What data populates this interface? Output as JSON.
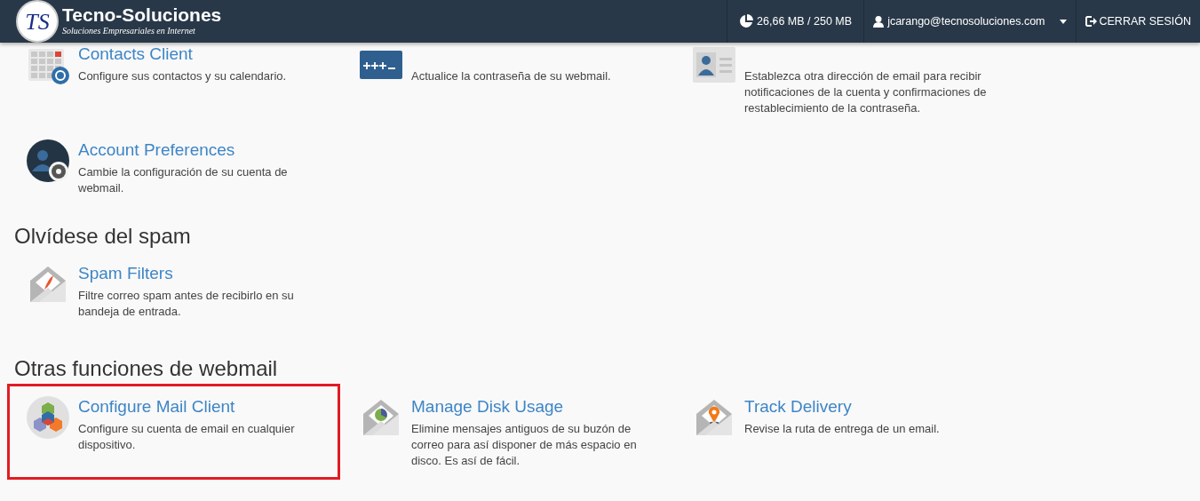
{
  "header": {
    "logo_mark": "TS",
    "brand": "Tecno-Soluciones",
    "tagline": "Soluciones Empresariales en Internet",
    "quota": "26,66 MB / 250 MB",
    "user": "jcarango@tecnosoluciones.com",
    "logout": "CERRAR SESIÓN"
  },
  "sections": [
    {
      "items": [
        {
          "kind": "calendar",
          "title": "Contacts Client",
          "description": "Configure sus contactos y su calendario.",
          "highlighted": false
        },
        {
          "kind": "password",
          "description": "Actualice la contraseña de su webmail.",
          "highlighted": false
        },
        {
          "kind": "contact",
          "description": "Establezca otra dirección de email para recibir notificaciones de la cuenta y confirmaciones de restablecimiento de la contraseña.",
          "highlighted": false
        },
        {
          "kind": "preferences",
          "title": "Account Preferences",
          "description": "Cambie la configuración de su cuenta de webmail.",
          "highlighted": false
        }
      ]
    },
    {
      "heading": "Olvídese del spam",
      "items": [
        {
          "kind": "spam",
          "title": "Spam Filters",
          "description": "Filtre correo spam antes de recibirlo en su bandeja de entrada.",
          "highlighted": false
        }
      ]
    },
    {
      "heading": "Otras funciones de webmail",
      "items": [
        {
          "kind": "mailclient",
          "title": "Configure Mail Client",
          "description": "Configure su cuenta de email en cualquier dispositivo.",
          "highlighted": true
        },
        {
          "kind": "disk",
          "title": "Manage Disk Usage",
          "description": "Elimine mensajes antiguos de su buzón de correo para así disponer de más espacio en disco. Es así de fácil.",
          "highlighted": false
        },
        {
          "kind": "track",
          "title": "Track Delivery",
          "description": "Revise la ruta de entrega de un email.",
          "highlighted": false
        }
      ]
    }
  ]
}
